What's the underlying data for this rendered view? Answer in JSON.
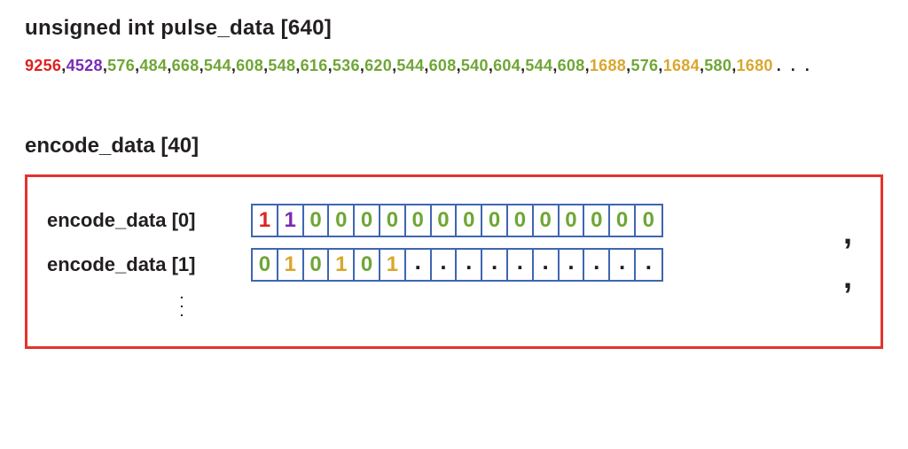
{
  "headings": {
    "pulse_array": "unsigned int pulse_data [640]",
    "encode_array": "encode_data [40]"
  },
  "pulse_sequence": [
    {
      "value": "9256",
      "color": "red"
    },
    {
      "value": "4528",
      "color": "purple"
    },
    {
      "value": "576",
      "color": "green"
    },
    {
      "value": "484",
      "color": "green"
    },
    {
      "value": "668",
      "color": "green"
    },
    {
      "value": "544",
      "color": "green"
    },
    {
      "value": "608",
      "color": "green"
    },
    {
      "value": "548",
      "color": "green"
    },
    {
      "value": "616",
      "color": "green"
    },
    {
      "value": "536",
      "color": "green"
    },
    {
      "value": "620",
      "color": "green"
    },
    {
      "value": "544",
      "color": "green"
    },
    {
      "value": "608",
      "color": "green"
    },
    {
      "value": "540",
      "color": "green"
    },
    {
      "value": "604",
      "color": "green"
    },
    {
      "value": "544",
      "color": "green"
    },
    {
      "value": "608",
      "color": "green"
    },
    {
      "value": "1688",
      "color": "gold"
    },
    {
      "value": "576",
      "color": "green"
    },
    {
      "value": "1684",
      "color": "gold"
    },
    {
      "value": "580",
      "color": "green"
    },
    {
      "value": "1680",
      "color": "gold"
    }
  ],
  "pulse_trailing_ellipsis": ". . .",
  "encode_rows": [
    {
      "label": "encode_data [0]",
      "bits": [
        {
          "v": "1",
          "color": "red"
        },
        {
          "v": "1",
          "color": "purple"
        },
        {
          "v": "0",
          "color": "green"
        },
        {
          "v": "0",
          "color": "green"
        },
        {
          "v": "0",
          "color": "green"
        },
        {
          "v": "0",
          "color": "green"
        },
        {
          "v": "0",
          "color": "green"
        },
        {
          "v": "0",
          "color": "green"
        },
        {
          "v": "0",
          "color": "green"
        },
        {
          "v": "0",
          "color": "green"
        },
        {
          "v": "0",
          "color": "green"
        },
        {
          "v": "0",
          "color": "green"
        },
        {
          "v": "0",
          "color": "green"
        },
        {
          "v": "0",
          "color": "green"
        },
        {
          "v": "0",
          "color": "green"
        },
        {
          "v": "0",
          "color": "green"
        }
      ],
      "comma": ","
    },
    {
      "label": "encode_data [1]",
      "bits": [
        {
          "v": "0",
          "color": "green"
        },
        {
          "v": "1",
          "color": "gold"
        },
        {
          "v": "0",
          "color": "green"
        },
        {
          "v": "1",
          "color": "gold"
        },
        {
          "v": "0",
          "color": "green"
        },
        {
          "v": "1",
          "color": "gold"
        },
        {
          "v": ".",
          "color": "dot"
        },
        {
          "v": ".",
          "color": "dot"
        },
        {
          "v": ".",
          "color": "dot"
        },
        {
          "v": ".",
          "color": "dot"
        },
        {
          "v": ".",
          "color": "dot"
        },
        {
          "v": ".",
          "color": "dot"
        },
        {
          "v": ".",
          "color": "dot"
        },
        {
          "v": ".",
          "color": "dot"
        },
        {
          "v": ".",
          "color": "dot"
        },
        {
          "v": ".",
          "color": "dot"
        }
      ],
      "comma": ","
    }
  ],
  "vertical_dots": "."
}
